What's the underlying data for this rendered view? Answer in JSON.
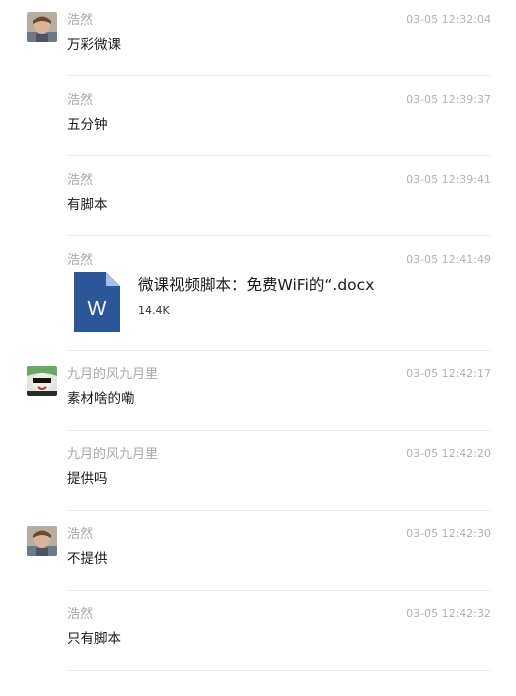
{
  "messages": [
    {
      "sender": "浩然",
      "time": "03-05 12:32:04",
      "text": "万彩微课",
      "avatar": "haoran"
    },
    {
      "sender": "浩然",
      "time": "03-05 12:39:37",
      "text": "五分钟"
    },
    {
      "sender": "浩然",
      "time": "03-05 12:39:41",
      "text": "有脚本"
    },
    {
      "sender": "浩然",
      "time": "03-05 12:41:49",
      "file": {
        "name": "微课视频脚本：免费WiFi的“.docx",
        "size": "14.4K",
        "icon": "word-document-icon",
        "icon_letter": "W"
      }
    },
    {
      "sender": "九月的风九月里",
      "time": "03-05 12:42:17",
      "text": "素材啥的嘞",
      "avatar": "jiuyue"
    },
    {
      "sender": "九月的风九月里",
      "time": "03-05 12:42:20",
      "text": "提供吗"
    },
    {
      "sender": "浩然",
      "time": "03-05 12:42:30",
      "text": "不提供",
      "avatar": "haoran"
    },
    {
      "sender": "浩然",
      "time": "03-05 12:42:32",
      "text": "只有脚本"
    }
  ],
  "colors": {
    "word_blue": "#2b579a",
    "word_fold": "#a5c0e6",
    "timestamp": "#b2b2b2",
    "sender": "#a8a8a8",
    "divider": "#ececec"
  }
}
